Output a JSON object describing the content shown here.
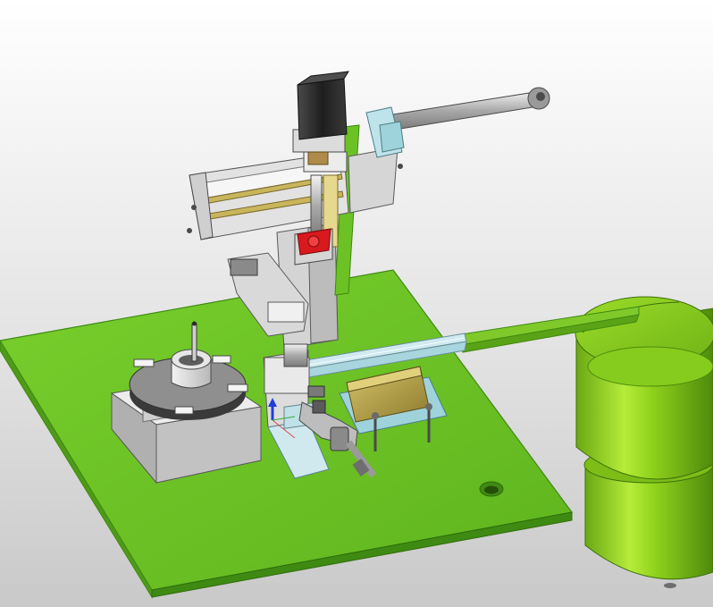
{
  "viewport": {
    "background_top": "#ffffff",
    "background_bottom": "#c9c9c9"
  },
  "colors": {
    "base_plate": "#6cc224",
    "base_plate_edge": "#3f8a12",
    "feeder_bowl": "#8fd21c",
    "feeder_bowl_dark": "#5d9a10",
    "metal_light": "#e8e8e8",
    "metal_mid": "#bfbfbf",
    "metal_dark": "#6a6a6a",
    "motor_black": "#2b2b2b",
    "rail_cyan": "#bfe3ea",
    "brass": "#b5a24a",
    "red_coupling": "#d8191e",
    "axis_blue": "#1f3fd8"
  },
  "components": [
    {
      "name": "base-plate"
    },
    {
      "name": "vibratory-bowl-feeder"
    },
    {
      "name": "linear-feed-track"
    },
    {
      "name": "stepper-motor"
    },
    {
      "name": "horizontal-slide-module"
    },
    {
      "name": "pneumatic-cylinder"
    },
    {
      "name": "rotary-index-table"
    },
    {
      "name": "escapement-cylinder"
    },
    {
      "name": "part-holder-block"
    }
  ]
}
